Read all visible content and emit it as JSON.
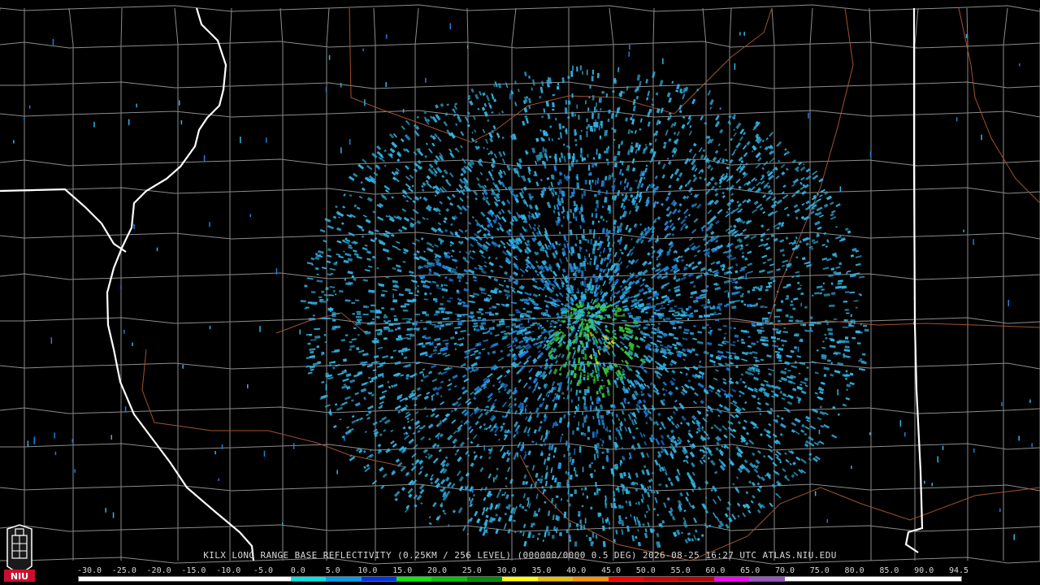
{
  "title_text": "KILX LONG RANGE BASE REFLECTIVITY (0.25KM / 256 LEVEL) (000000/0000 0.5 DEG) 2026-08-25 16:27 UTC  ATLAS.NIU.EDU",
  "scale_labels": [
    "-30.0",
    "-25.0",
    "-20.0",
    "-15.0",
    "-10.0",
    "-5.0",
    "0.0",
    "5.0",
    "10.0",
    "15.0",
    "20.0",
    "25.0",
    "30.0",
    "35.0",
    "40.0",
    "45.0",
    "50.0",
    "55.0",
    "60.0",
    "65.0",
    "70.0",
    "75.0",
    "80.0",
    "85.0",
    "90.0",
    "94.5"
  ],
  "colorbar_colors": [
    "#ffffff",
    "#ffffff",
    "#ffffff",
    "#ffffff",
    "#ffffff",
    "#ffffff",
    "#00e5e5",
    "#009fef",
    "#0033f0",
    "#00ef00",
    "#00c800",
    "#008f00",
    "#ffff00",
    "#e7c000",
    "#ff9000",
    "#ff0000",
    "#d60000",
    "#c00000",
    "#ff00ff",
    "#9955c9",
    "#ffffff",
    "#ffffff",
    "#ffffff",
    "#ffffff",
    "#ffffff"
  ],
  "logo": {
    "text": "NIU",
    "color": "#c8102e"
  },
  "map_colors": {
    "county": "#8c8c8c",
    "state": "#ffffff",
    "river": "#a0522d",
    "echo_light": "#33b5e5",
    "echo_mid": "#1e7fdc",
    "echo_high": "#39c83a",
    "echo_peak": "#e0d020"
  }
}
